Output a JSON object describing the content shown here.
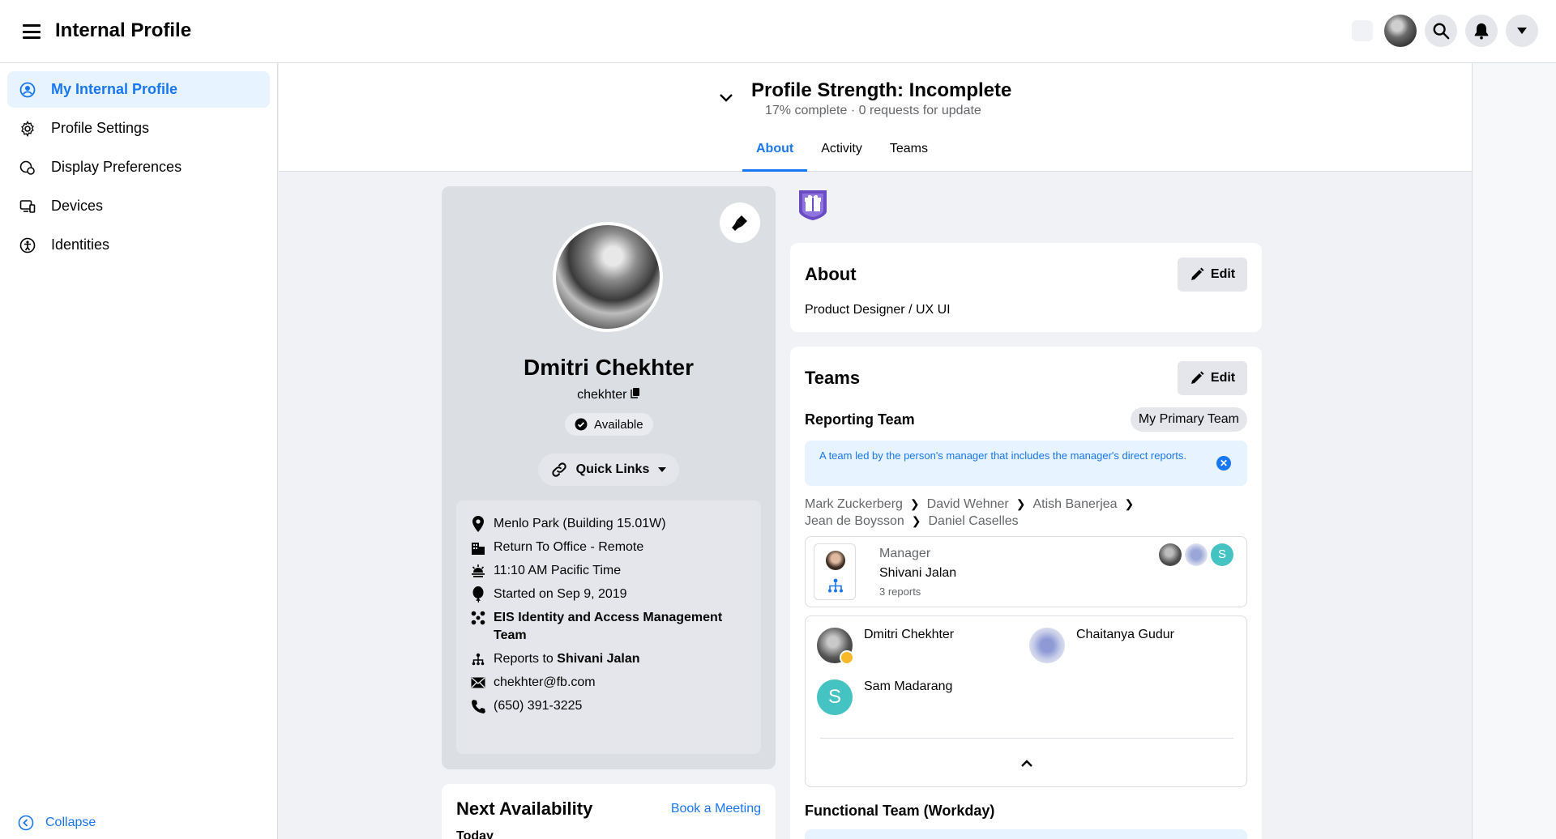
{
  "app": {
    "title": "Internal Profile"
  },
  "sidebar": {
    "items": [
      {
        "label": "My Internal Profile",
        "icon": "user-circle-icon",
        "active": true
      },
      {
        "label": "Profile Settings",
        "icon": "gear-icon",
        "active": false
      },
      {
        "label": "Display Preferences",
        "icon": "display-preferences-icon",
        "active": false
      },
      {
        "label": "Devices",
        "icon": "devices-icon",
        "active": false
      },
      {
        "label": "Identities",
        "icon": "identities-icon",
        "active": false
      }
    ],
    "collapse_label": "Collapse"
  },
  "header": {
    "strength_title": "Profile Strength: Incomplete",
    "strength_sub": "17% complete · 0 requests for update",
    "percent_complete": 17,
    "tabs": [
      {
        "label": "About",
        "active": true
      },
      {
        "label": "Activity",
        "active": false
      },
      {
        "label": "Teams",
        "active": false
      }
    ]
  },
  "profile": {
    "name": "Dmitri Chekhter",
    "handle": "chekhter",
    "status": "Available",
    "quick_links_label": "Quick Links",
    "info": {
      "location": "Menlo Park (Building 15.01W)",
      "return_to_office": "Return To Office - Remote",
      "local_time": "11:10 AM Pacific Time",
      "start_date": "Started on Sep 9, 2019",
      "team": "EIS Identity and Access Management Team",
      "reports_to_prefix": "Reports to",
      "reports_to_name": "Shivani Jalan",
      "email": "chekhter@fb.com",
      "phone": "(650) 391-3225"
    }
  },
  "availability": {
    "title": "Next Availability",
    "book_label": "Book a Meeting",
    "today_label": "Today"
  },
  "about": {
    "title": "About",
    "edit_label": "Edit",
    "text": "Product Designer / UX UI"
  },
  "teams": {
    "title": "Teams",
    "edit_label": "Edit",
    "reporting_title": "Reporting Team",
    "primary_label": "My Primary Team",
    "banner_text": "A team led by the person's manager that includes the manager's direct reports.",
    "chain": [
      "Mark Zuckerberg",
      "David Wehner",
      "Atish Banerjea",
      "Jean de Boysson",
      "Daniel Caselles"
    ],
    "manager": {
      "label": "Manager",
      "name": "Shivani Jalan",
      "reports": "3 reports"
    },
    "members": [
      {
        "name": "Dmitri Chekhter"
      },
      {
        "name": "Chaitanya Gudur"
      },
      {
        "name": "Sam Madarang",
        "initial": "S"
      }
    ],
    "functional_title": "Functional Team (Workday)"
  },
  "colors": {
    "accent": "#1877f2",
    "teal_avatar": "#45c2c2",
    "badge_purple": "#6a4bc4"
  }
}
